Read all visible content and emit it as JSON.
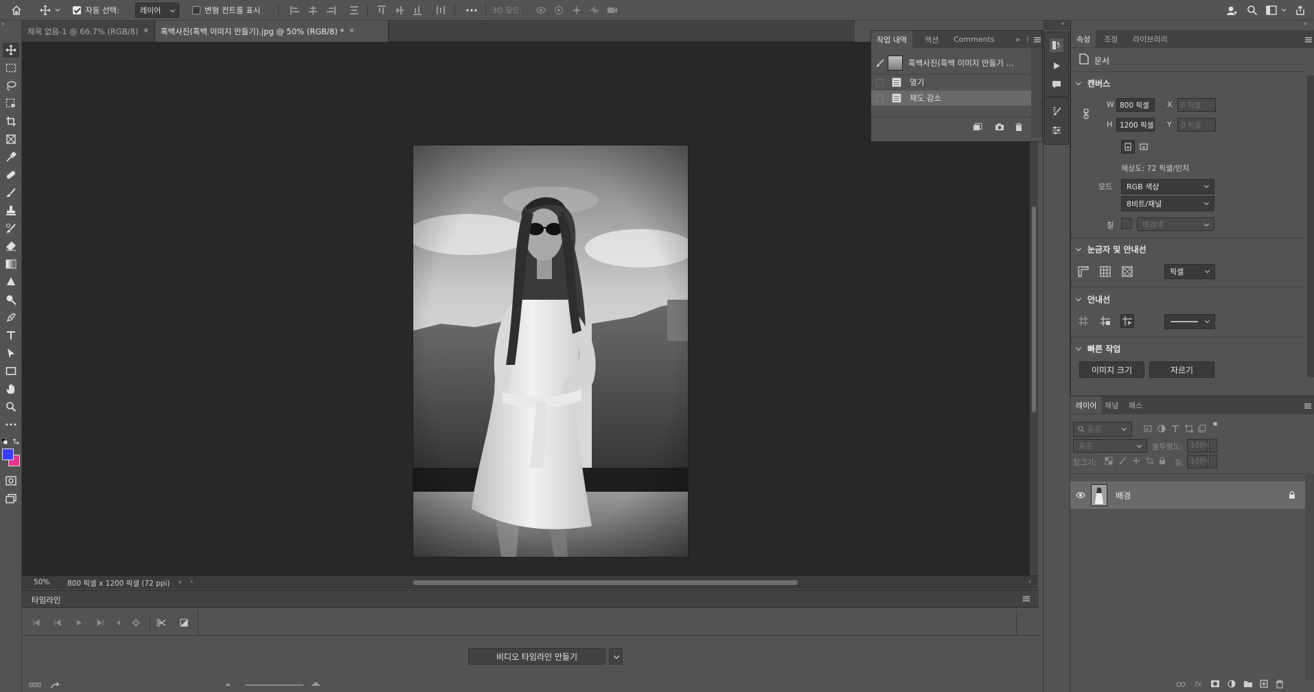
{
  "options_bar": {
    "auto_select_label": "자동 선택:",
    "auto_select_target": "레이어",
    "transform_controls_label": "변형 컨트롤 표시",
    "mode_3d_label": "3D 모드:"
  },
  "tabs": [
    {
      "label": "제목 없음-1 @ 66.7% (RGB/8)"
    },
    {
      "label": "흑백사진(흑백 이미지 만들기).jpg @ 50% (RGB/8) *"
    }
  ],
  "status": {
    "zoom": "50%",
    "doc_info": "800 픽셀 x 1200 픽셀 (72 ppi)"
  },
  "timeline": {
    "title": "타임라인",
    "create_button": "비디오 타임라인 만들기"
  },
  "history_panel": {
    "tabs": [
      "작업 내역",
      "액션",
      "Comments"
    ],
    "snapshot": "흑백사진(흑백 이미지 만들기 ...",
    "items": [
      "열기",
      "채도 감소"
    ]
  },
  "properties": {
    "tabs": [
      "속성",
      "조정",
      "라이브러리"
    ],
    "doc_label": "문서",
    "canvas": {
      "title": "캔버스",
      "w_label": "W",
      "w_value": "800 픽셀",
      "h_label": "H",
      "h_value": "1200 픽셀",
      "x_label": "X",
      "x_value": "0 픽셀",
      "y_label": "Y",
      "y_value": "0 픽셀",
      "resolution": "해상도: 72 픽셀/인치",
      "mode_label": "모드",
      "mode_value": "RGB 색상",
      "bit_value": "8비트/채널",
      "fill_label": "칠",
      "fill_value": "배경색"
    },
    "rulers": {
      "title": "눈금자 및 안내선",
      "unit": "픽셀"
    },
    "guides": {
      "title": "안내선"
    },
    "quick_actions": {
      "title": "빠른 작업",
      "image_size": "이미지 크기",
      "crop": "자르기"
    }
  },
  "layers": {
    "tabs": [
      "레이어",
      "채널",
      "패스"
    ],
    "filter_placeholder": "종류",
    "blend_mode": "표준",
    "opacity_label": "불투명도:",
    "opacity_value": "100%",
    "lock_label": "잠그기:",
    "fill_label": "칠:",
    "fill_value": "100%",
    "layer_name": "배경"
  },
  "colors": {
    "foreground": "#3d3dff",
    "background": "#e8348c"
  }
}
